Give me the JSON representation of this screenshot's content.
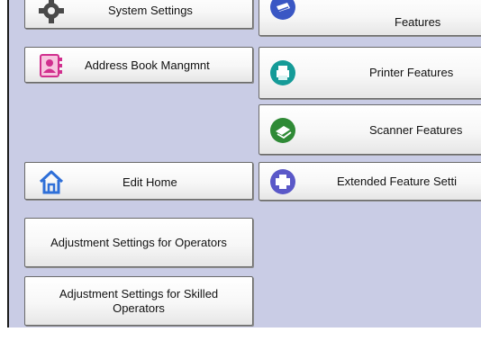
{
  "left_column": {
    "system_settings": "System Settings",
    "address_book": "Address Book Mangmnt",
    "edit_home": "Edit Home",
    "adjust_operators": "Adjustment Settings for Operators",
    "adjust_skilled": "Adjustment Settings for Skilled Operators"
  },
  "right_column": {
    "features": "Features",
    "printer": "Printer Features",
    "scanner": "Scanner Features",
    "extended": "Extended Feature Setti"
  },
  "colors": {
    "panel_bg": "#c9cce5",
    "button_border": "#6a6a6a",
    "icon_blue": "#3a57c4",
    "icon_teal": "#159b98",
    "icon_green": "#2f8a36",
    "icon_purple": "#5a58c8",
    "icon_pink": "#d12f8e"
  }
}
